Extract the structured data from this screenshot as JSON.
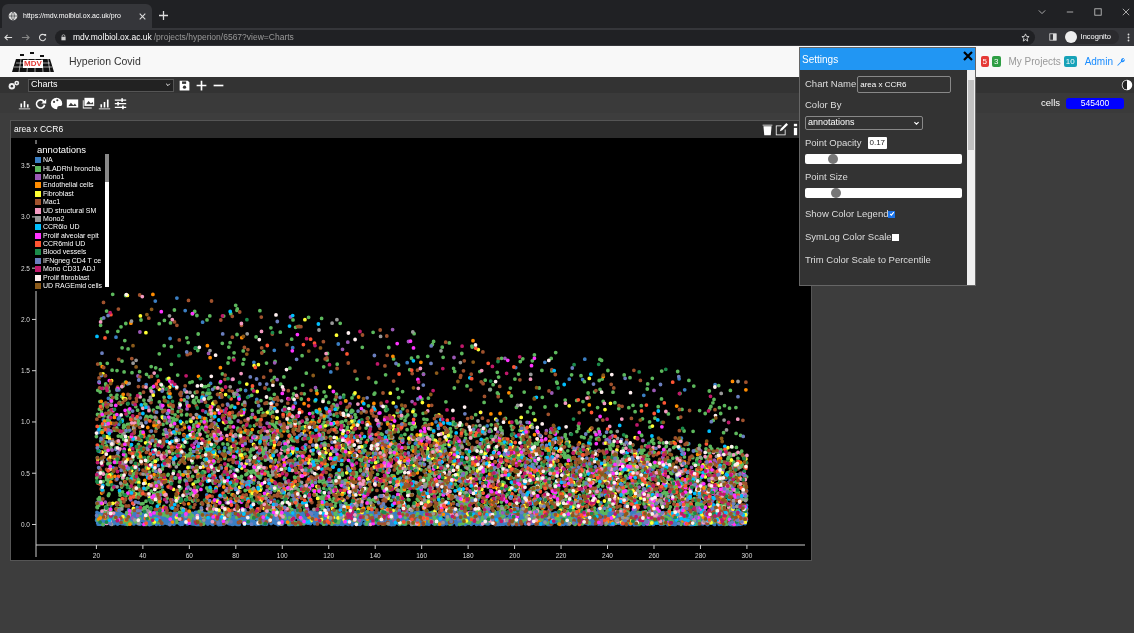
{
  "browser": {
    "tab_title": "https://mdv.molbiol.ox.ac.uk/pro",
    "url_host": "mdv.molbiol.ox.ac.uk",
    "url_path": "/projects/hyperion/6567?view=Charts",
    "profile": "Incognito"
  },
  "header": {
    "logo_text": "MDV",
    "project": "Hyperion Covid",
    "badges": [
      {
        "text": "5",
        "color": "#e53935"
      },
      {
        "text": "3",
        "color": "#2e9e44"
      }
    ],
    "my_projects": "My Projects",
    "my_projects_count": "10",
    "admin": "Admin"
  },
  "toolbar": {
    "view": "Charts",
    "cells_label": "cells",
    "cells_count": "545400"
  },
  "chart": {
    "title": "area x CCR6",
    "legend": {
      "title": "annotations",
      "items": [
        {
          "label": "NA",
          "color": "#3b7fc4"
        },
        {
          "label": "HLADRhi bronchia",
          "color": "#5cb85c"
        },
        {
          "label": "Mono1",
          "color": "#9b59b6"
        },
        {
          "label": "Endothelial cells",
          "color": "#ff8c00"
        },
        {
          "label": "Fibroblast",
          "color": "#ffff33"
        },
        {
          "label": "Mac1",
          "color": "#a0522d"
        },
        {
          "label": "UD structural SM",
          "color": "#f49ac2"
        },
        {
          "label": "Mono2",
          "color": "#999999"
        },
        {
          "label": "CCR6lo UD",
          "color": "#00bfff"
        },
        {
          "label": "Prolif alveolar epit",
          "color": "#ff33ff"
        },
        {
          "label": "CCR6mid UD",
          "color": "#ff5533"
        },
        {
          "label": "Blood vessels",
          "color": "#1b8a4a"
        },
        {
          "label": "IFNgneg CD4 T ce",
          "color": "#6b7fbf"
        },
        {
          "label": "Mono CD31 ADJ",
          "color": "#c0186b"
        },
        {
          "label": "Prolif fibroblast",
          "color": "#fff0f0"
        },
        {
          "label": "UD RAGEmid cells",
          "color": "#8b5a1a"
        }
      ]
    },
    "chart_data": {
      "type": "scatter",
      "xlim": [
        -6,
        325
      ],
      "ylim": [
        -0.2,
        3.75
      ],
      "xticks": [
        20,
        40,
        60,
        80,
        100,
        120,
        140,
        160,
        180,
        200,
        220,
        240,
        260,
        280,
        300
      ],
      "yticks": [
        {
          "value": 0,
          "label": "0.0"
        },
        {
          "value": 0.5,
          "label": "0.5"
        },
        {
          "value": 1,
          "label": "1.0"
        },
        {
          "value": 1.5,
          "label": "1.5"
        },
        {
          "value": 2,
          "label": "2.0"
        },
        {
          "value": 2.5,
          "label": "2.5"
        },
        {
          "value": 3,
          "label": "3.0"
        },
        {
          "value": 3.5,
          "label": "3.5"
        }
      ]
    }
  },
  "settings": {
    "title": "Settings",
    "chart_name_label": "Chart Name",
    "chart_name": "area x CCR6",
    "color_by_label": "Color By",
    "color_by": "annotations",
    "controls": [
      {
        "kind": "slider",
        "label": "Point Opacity",
        "level": 0.18,
        "tooltip": "0.17"
      },
      {
        "kind": "slider",
        "label": "Point Size",
        "level": 0.2
      },
      {
        "kind": "checkbox",
        "label": "Show Color Legend",
        "checked": true
      },
      {
        "kind": "checkbox",
        "label": "SymLog Color Scale",
        "checked": false
      },
      {
        "kind": "heading",
        "label": "Trim Color Scale to Percentile"
      }
    ]
  }
}
